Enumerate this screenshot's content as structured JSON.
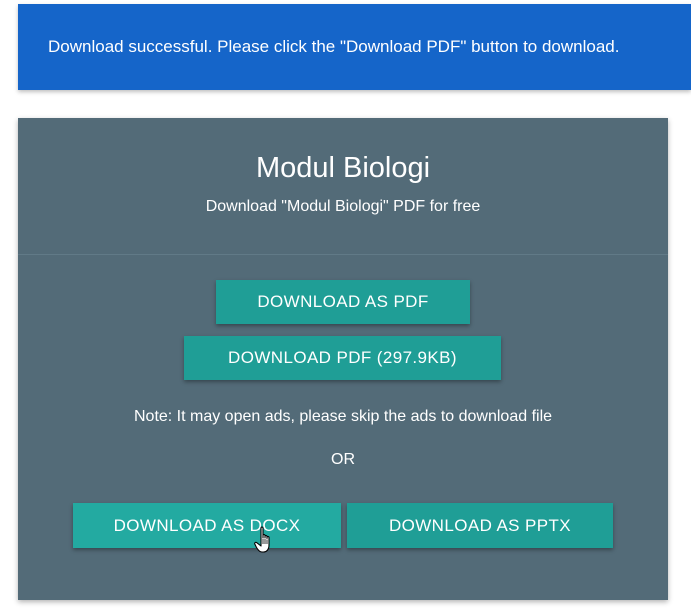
{
  "alert": {
    "message": "Download successful. Please click the \"Download PDF\" button to download."
  },
  "card": {
    "title": "Modul Biologi",
    "subtitle": "Download \"Modul Biologi\" PDF for free",
    "buttons": {
      "download_pdf": "DOWNLOAD AS PDF",
      "download_pdf_size": "DOWNLOAD PDF (297.9KB)",
      "download_docx": "DOWNLOAD AS DOCX",
      "download_pptx": "DOWNLOAD AS PPTX"
    },
    "note": "Note: It may open ads, please skip the ads to download file",
    "or": "OR"
  },
  "colors": {
    "alert_bg": "#1565c9",
    "card_bg": "#536b78",
    "button_bg": "#1f9e96"
  },
  "icons": {
    "cursor": "hand-pointer-cursor-icon"
  }
}
